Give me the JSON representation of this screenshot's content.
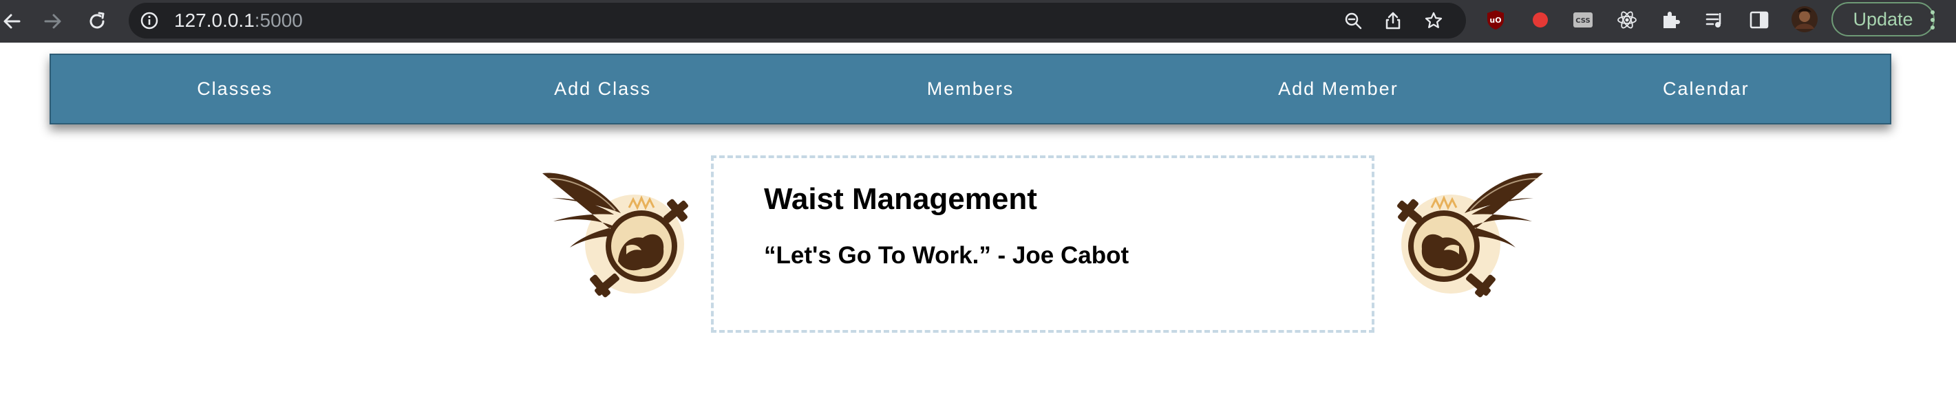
{
  "browser": {
    "url_host": "127.0.0.1",
    "url_port": ":5000",
    "update_label": "Update",
    "icons": [
      "back-icon",
      "forward-icon",
      "reload-icon",
      "site-info-icon",
      "zoom-icon",
      "share-icon",
      "bookmark-star-icon",
      "ublock-icon",
      "record-icon",
      "css-icon",
      "react-icon",
      "extensions-icon",
      "reading-list-icon",
      "side-panel-icon",
      "profile-avatar",
      "more-menu-icon"
    ]
  },
  "nav": {
    "items": [
      {
        "label": "Classes"
      },
      {
        "label": "Add Class"
      },
      {
        "label": "Members"
      },
      {
        "label": "Add Member"
      },
      {
        "label": "Calendar"
      }
    ]
  },
  "hero": {
    "title": "Waist Management",
    "quote": "“Let's Go To Work.” - Joe Cabot"
  },
  "colors": {
    "navbar": "#437e9e",
    "hero_border": "#c6d8e4",
    "logo_brown": "#4a2a12",
    "logo_gold": "#e8b15a"
  }
}
